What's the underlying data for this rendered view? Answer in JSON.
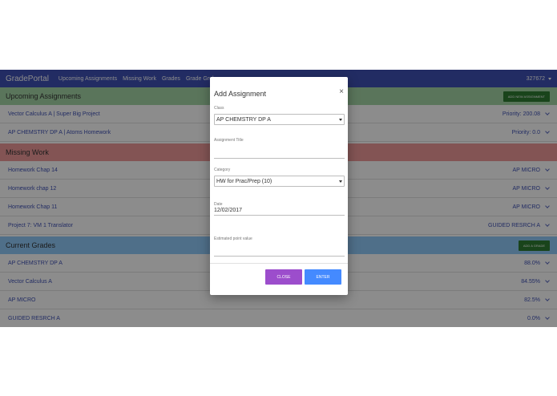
{
  "navbar": {
    "brand": "GradePortal",
    "links": [
      "Upcoming Assignments",
      "Missing Work",
      "Grades",
      "Grade Grub"
    ],
    "user": "327672"
  },
  "upcoming": {
    "title": "Upcoming Assignments",
    "button": "ADD NEW ASSIGNMENT",
    "color": "#a5d6a7",
    "rows": [
      {
        "label": "Vector Calculus A | Super Big Project",
        "value": "Priority: 200.08"
      },
      {
        "label": "AP CHEMSTRY DP A | Atoms Homework",
        "value": "Priority: 0.0"
      }
    ]
  },
  "missing": {
    "title": "Missing Work",
    "color": "#ef9a9a",
    "rows": [
      {
        "label": "Homework Chap 14",
        "value": "AP MICRO"
      },
      {
        "label": "Homework chap 12",
        "value": "AP MICRO"
      },
      {
        "label": "Homework Chap 11",
        "value": "AP MICRO"
      },
      {
        "label": "Project 7: VM 1 Translator",
        "value": "GUIDED RESRCH A"
      }
    ]
  },
  "grades": {
    "title": "Current Grades",
    "button": "ADD A GRADE",
    "color": "#90caf9",
    "rows": [
      {
        "label": "AP CHEMSTRY DP A",
        "value": "88.0%"
      },
      {
        "label": "Vector Calculus A",
        "value": "84.55%"
      },
      {
        "label": "AP MICRO",
        "value": "82.5%"
      },
      {
        "label": "GUIDED RESRCH A",
        "value": "0.0%"
      }
    ]
  },
  "modal": {
    "title": "Add Assignment",
    "close_glyph": "×",
    "class_label": "Class",
    "class_value": "AP CHEMSTRY DP A",
    "title_label": "Assignment Title",
    "title_value": "",
    "category_label": "Category",
    "category_value": "HW for Prac/Prep (10)",
    "date_label": "Date",
    "date_value": "12/02/2017",
    "points_label": "Estimated point value",
    "points_value": "",
    "close_button": "CLOSE",
    "enter_button": "ENTER"
  }
}
